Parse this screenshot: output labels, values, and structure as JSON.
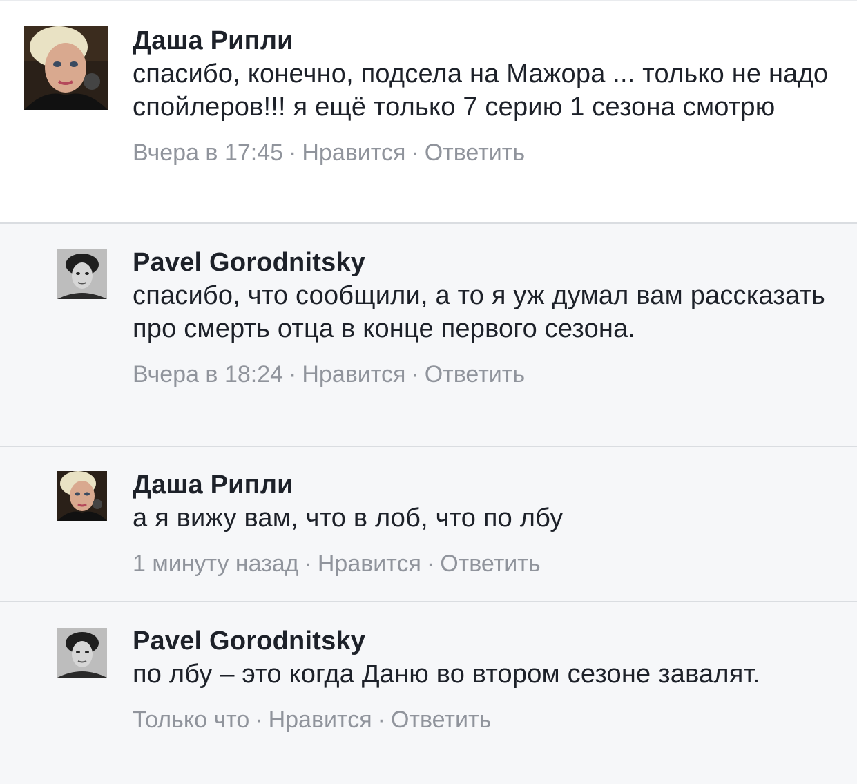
{
  "comments": [
    {
      "author": "Даша Рипли",
      "text": "спасибо, конечно, подсела на Мажора ... только не надо спойлеров!!! я ещё только 7 серию 1 сезона смотрю",
      "time": "Вчера в 17:45",
      "like_label": "Нравится",
      "reply_label": "Ответить",
      "avatar_icon": "woman-avatar-icon"
    },
    {
      "author": "Pavel Gorodnitsky",
      "text": "спасибо, что сообщили, а то я уж думал вам рассказать про смерть отца в конце первого сезона.",
      "time": "Вчера в 18:24",
      "like_label": "Нравится",
      "reply_label": "Ответить",
      "avatar_icon": "man-avatar-icon"
    },
    {
      "author": "Даша Рипли",
      "text": "а я вижу вам, что в лоб, что по лбу",
      "time": "1 минуту назад",
      "like_label": "Нравится",
      "reply_label": "Ответить",
      "avatar_icon": "woman-avatar-icon"
    },
    {
      "author": "Pavel Gorodnitsky",
      "text": "по лбу – это когда Даню во втором сезоне завалят.",
      "time": "Только что",
      "like_label": "Нравится",
      "reply_label": "Ответить",
      "avatar_icon": "man-avatar-icon"
    }
  ],
  "separator": "·",
  "colors": {
    "author": "#1d2129",
    "text": "#1d2129",
    "meta": "#90949c",
    "reply_background": "#f6f7f9",
    "top_background": "#ffffff"
  }
}
